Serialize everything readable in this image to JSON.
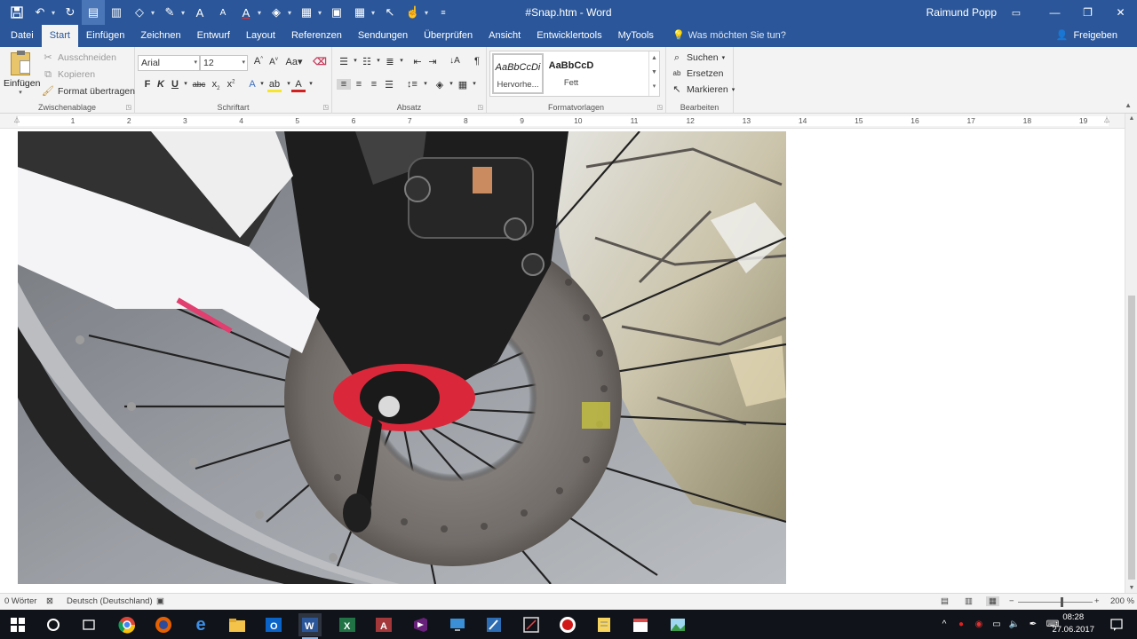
{
  "window": {
    "document_title": "#Snap.htm  -  Word",
    "user_name": "Raimund Popp"
  },
  "tabs": [
    {
      "label": "Datei"
    },
    {
      "label": "Start"
    },
    {
      "label": "Einfügen"
    },
    {
      "label": "Zeichnen"
    },
    {
      "label": "Entwurf"
    },
    {
      "label": "Layout"
    },
    {
      "label": "Referenzen"
    },
    {
      "label": "Sendungen"
    },
    {
      "label": "Überprüfen"
    },
    {
      "label": "Ansicht"
    },
    {
      "label": "Entwicklertools"
    },
    {
      "label": "MyTools"
    }
  ],
  "tell_me": "Was möchten Sie tun?",
  "share_label": "Freigeben",
  "ribbon": {
    "clipboard": {
      "label": "Zwischenablage",
      "paste": "Einfügen",
      "cut": "Ausschneiden",
      "copy": "Kopieren",
      "format_painter": "Format übertragen"
    },
    "font": {
      "label": "Schriftart",
      "font_name": "Arial",
      "font_size": "12",
      "bold": "F",
      "italic": "K",
      "underline": "U"
    },
    "paragraph": {
      "label": "Absatz"
    },
    "styles": {
      "label": "Formatvorlagen",
      "items": [
        {
          "sample": "AaBbCcDi",
          "name": "Hervorhe..."
        },
        {
          "sample": "AaBbCcD",
          "name": "Fett"
        }
      ]
    },
    "editing": {
      "label": "Bearbeiten",
      "find": "Suchen",
      "replace": "Ersetzen",
      "select": "Markieren"
    }
  },
  "ruler_numbers": [
    "1",
    "2",
    "3",
    "4",
    "5",
    "6",
    "7",
    "8",
    "9",
    "10",
    "11",
    "12",
    "13",
    "14",
    "15",
    "16",
    "17",
    "18",
    "19"
  ],
  "status": {
    "word_count": "0 Wörter",
    "language": "Deutsch (Deutschland)",
    "zoom": "200 %"
  },
  "clock": {
    "time": "08:28",
    "date": "27.06.2017"
  },
  "colors": {
    "word_blue": "#2b579a",
    "taskbar": "#101319"
  },
  "image": {
    "description_icon": "bicycle-disc-brake-photo"
  }
}
